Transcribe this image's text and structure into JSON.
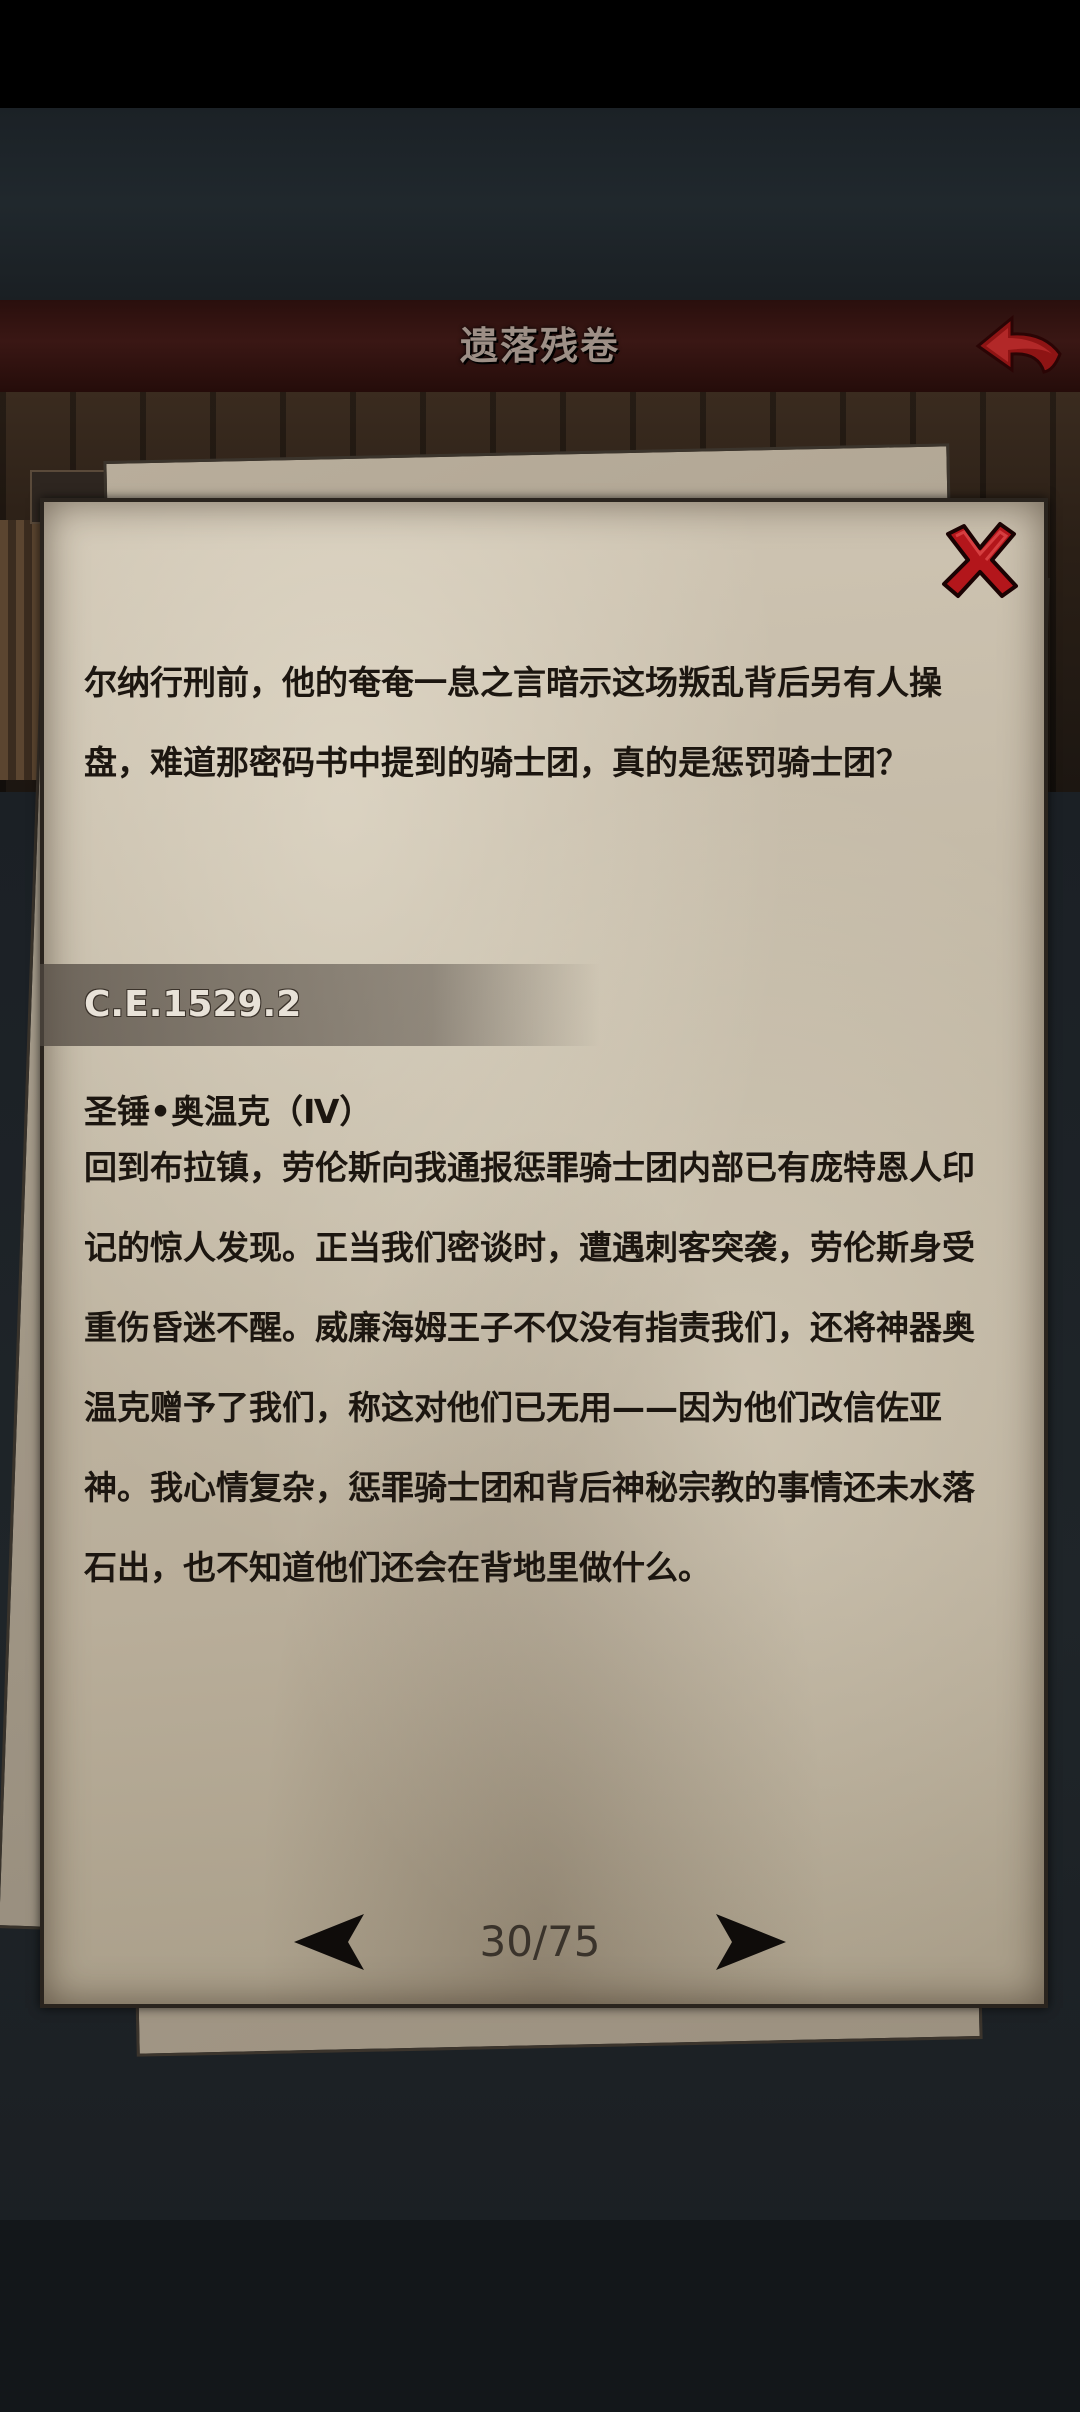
{
  "header": {
    "title": "遗落残卷",
    "back_icon": "back-arrow-icon"
  },
  "colors": {
    "title_bar": "#3a1714",
    "paper": "#c2b8a5",
    "text": "#1c1610",
    "close_red": "#c4161c",
    "date_band": "#5a524a"
  },
  "document": {
    "close_icon": "close-x-icon",
    "intro_paragraph": "尔纳行刑前，他的奄奄一息之言暗示这场叛乱背后另有人操盘，难道那密码书中提到的骑士团，真的是惩罚骑士团？",
    "date": "C.E.1529.2",
    "entry_title": "圣锤•奥温克（Ⅳ）",
    "entry_paragraph": "回到布拉镇，劳伦斯向我通报惩罪骑士团内部已有庞特恩人印记的惊人发现。正当我们密谈时，遭遇刺客突袭，劳伦斯身受重伤昏迷不醒。威廉海姆王子不仅没有指责我们，还将神器奥温克赠予了我们，称这对他们已无用——因为他们改信佐亚神。我心情复杂，惩罪骑士团和背后神秘宗教的事情还未水落石出，也不知道他们还会在背地里做什么。"
  },
  "pagination": {
    "current_label": "30/75",
    "current": 30,
    "total": 75,
    "prev_icon": "left-arrow-icon",
    "next_icon": "right-arrow-icon"
  }
}
